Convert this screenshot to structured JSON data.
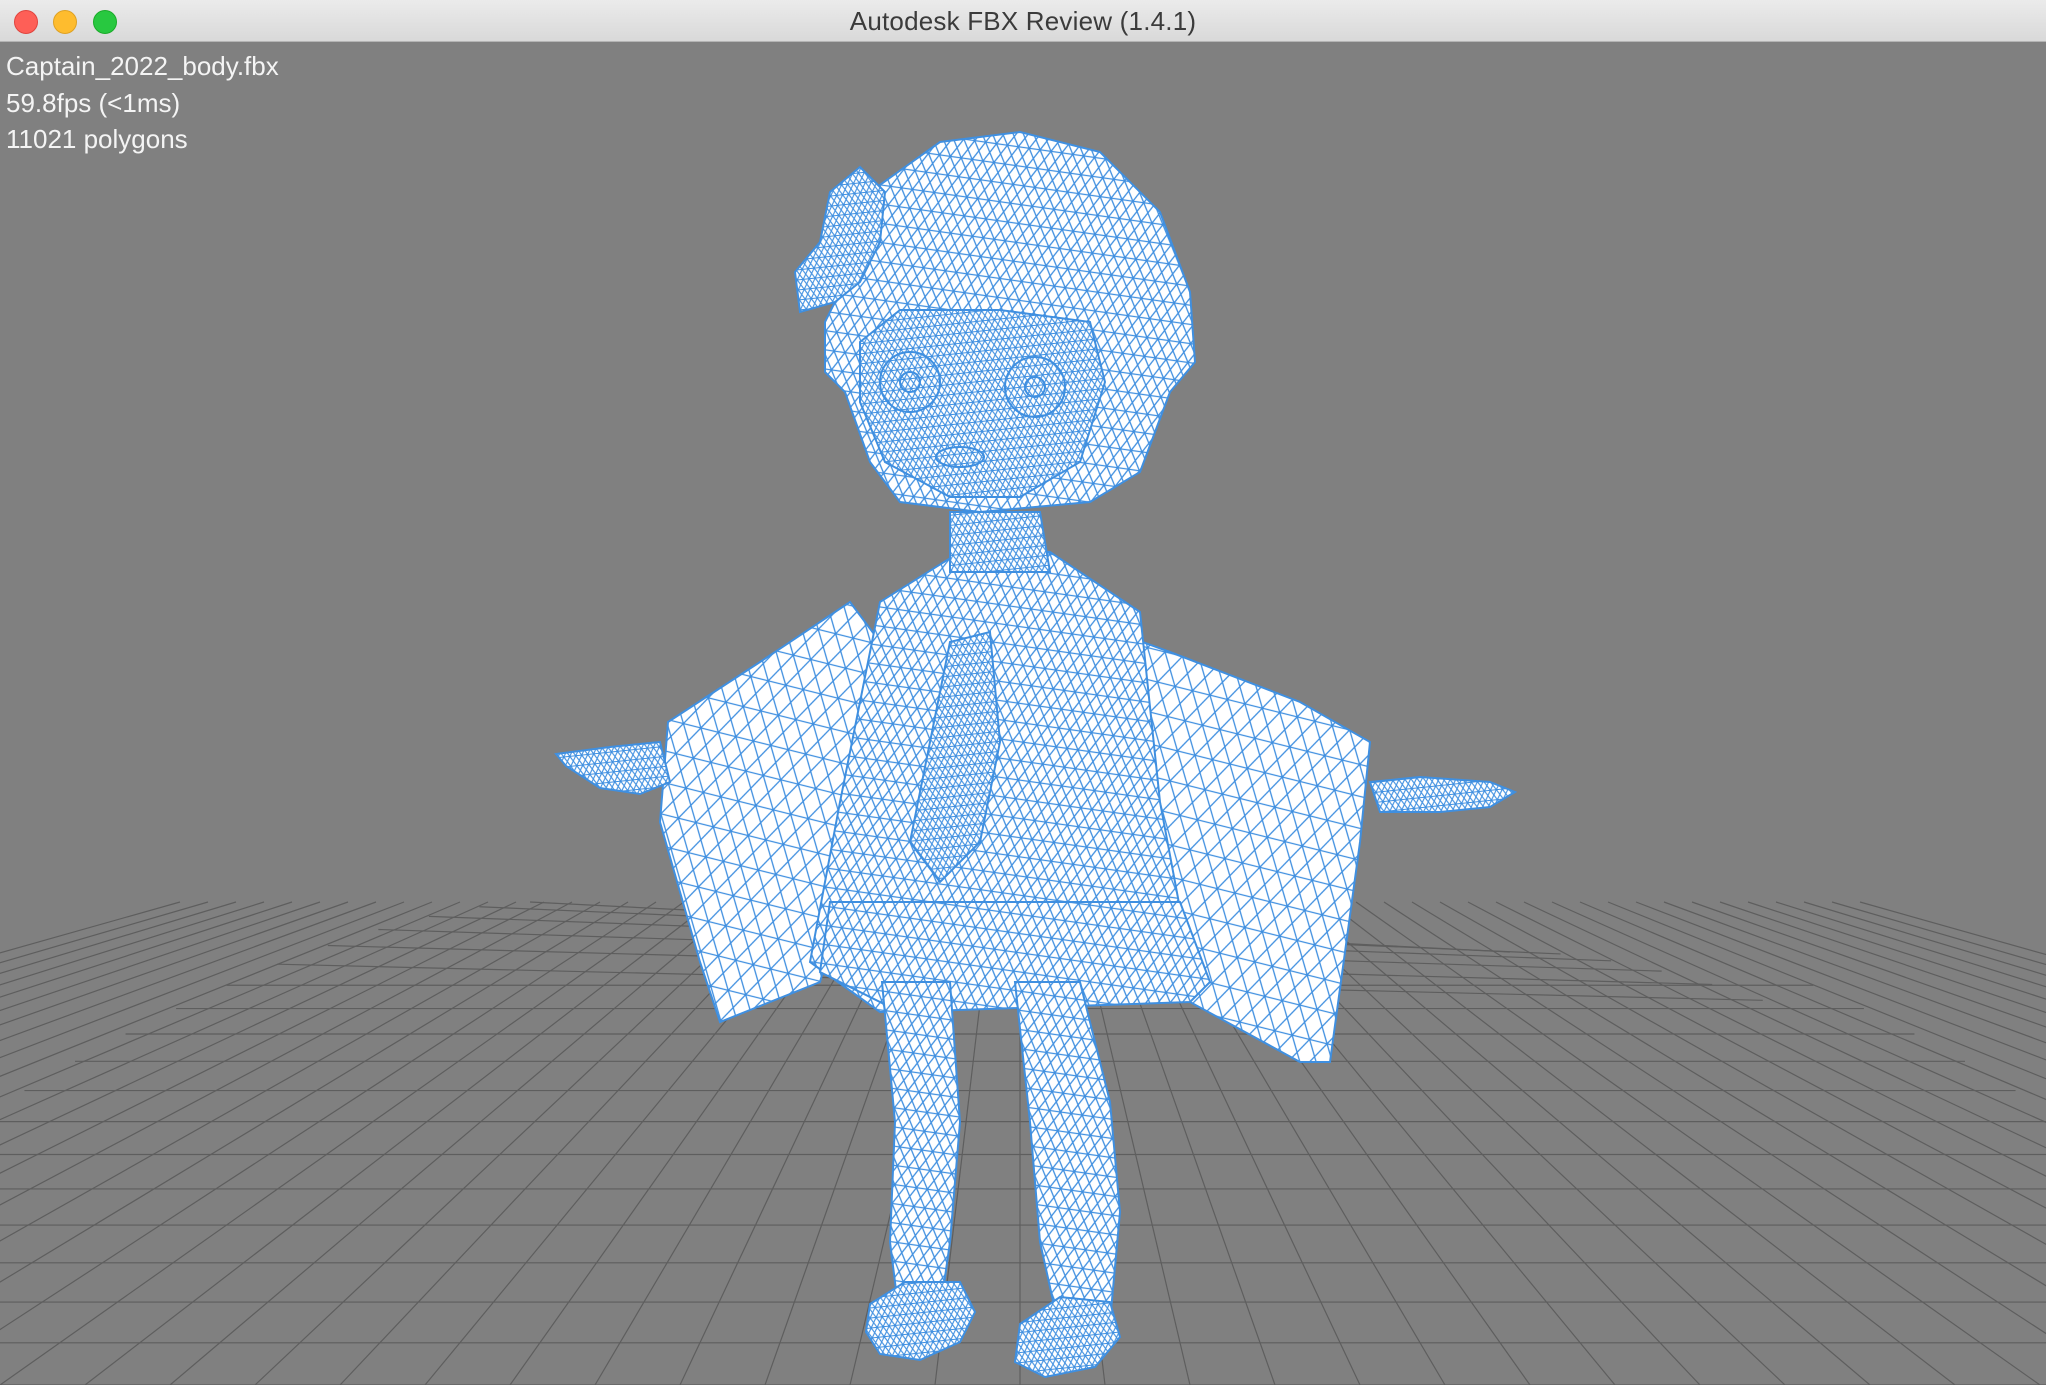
{
  "window": {
    "title": "Autodesk FBX Review (1.4.1)",
    "controls": [
      "close-button",
      "minimize-button",
      "zoom-button"
    ]
  },
  "hud": {
    "file_name": "Captain_2022_body.fbx",
    "fps": "59.8fps (<1ms)",
    "polygons": "11021 polygons"
  },
  "colors": {
    "background": "#808080",
    "grid": "#5a5a5a",
    "wireframe": "#3f8fe0",
    "wire_fill": "#ffffff"
  },
  "viewport": {
    "render_mode": "wireframe",
    "model": "chibi character in T-pose"
  }
}
